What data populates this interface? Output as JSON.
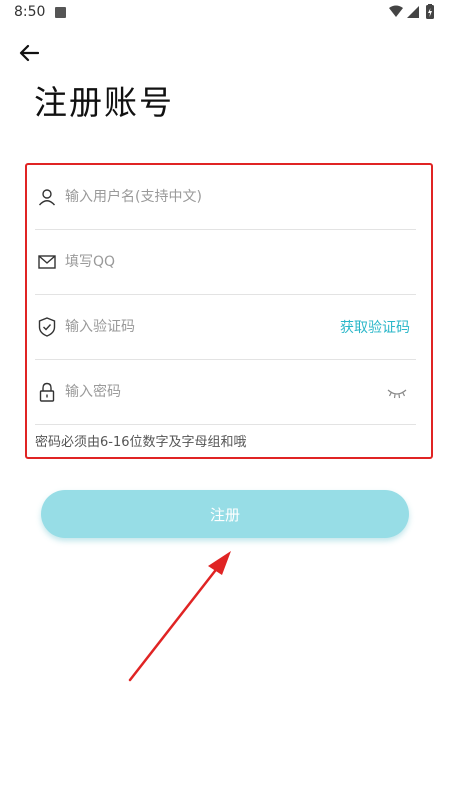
{
  "status_bar": {
    "time": "8:50"
  },
  "page": {
    "title": "注册账号"
  },
  "form": {
    "username": {
      "placeholder": "输入用户名(支持中文)",
      "value": ""
    },
    "qq": {
      "placeholder": "填写QQ",
      "value": ""
    },
    "code": {
      "placeholder": "输入验证码",
      "value": "",
      "get_code_label": "获取验证码"
    },
    "password": {
      "placeholder": "输入密码",
      "value": ""
    },
    "hint": "密码必须由6-16位数字及字母组和哦"
  },
  "register_button": {
    "label": "注册"
  },
  "colors": {
    "accent": "#2bb7c9",
    "button_bg": "#97dde6",
    "highlight_border": "#e02424"
  }
}
